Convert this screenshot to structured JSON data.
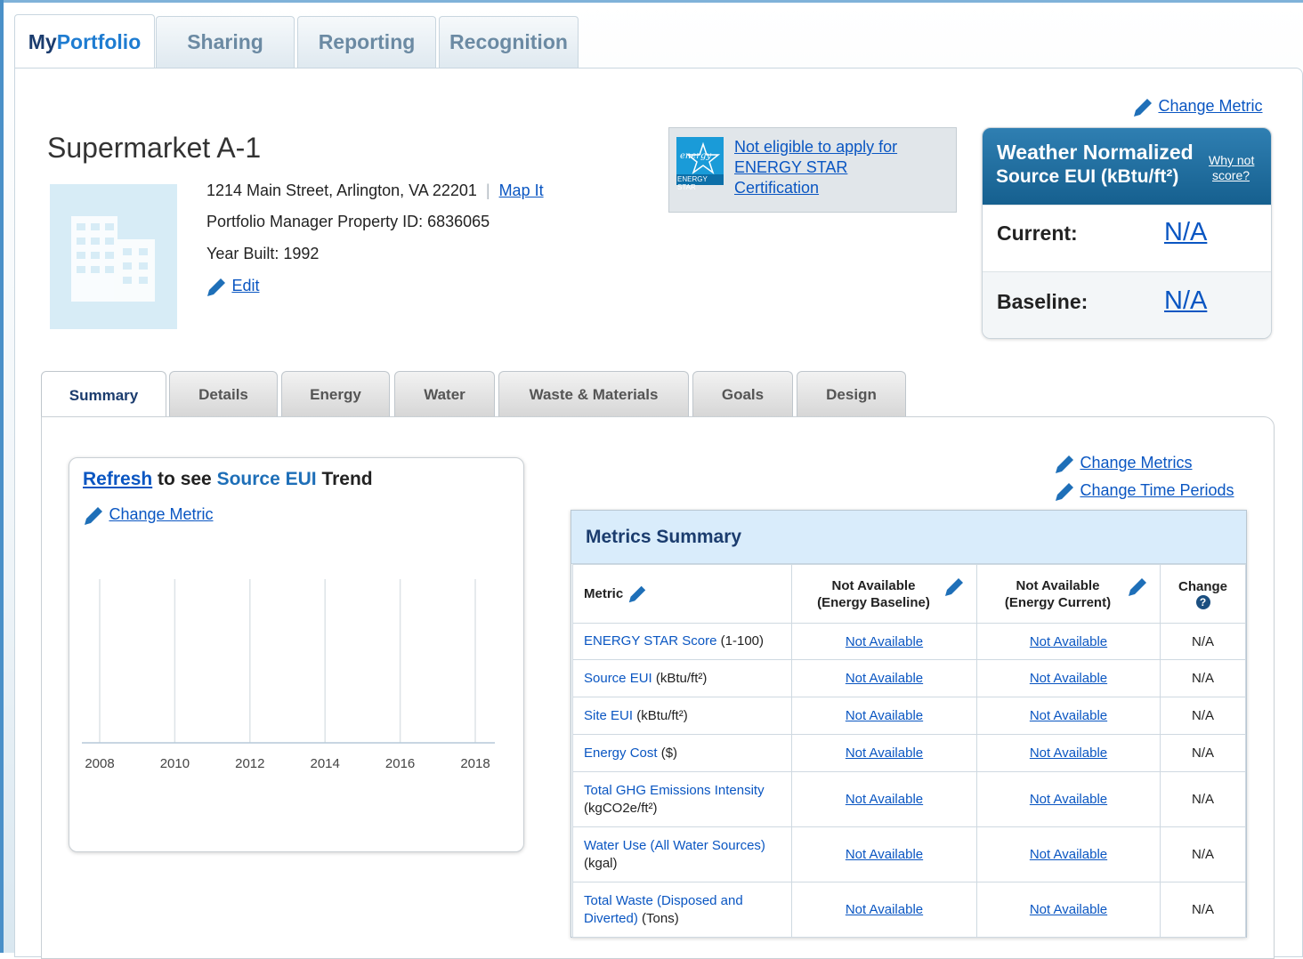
{
  "top_tabs": [
    {
      "label_a": "My",
      "label_b": "Portfolio"
    },
    {
      "label": "Sharing"
    },
    {
      "label": "Reporting"
    },
    {
      "label": "Recognition"
    }
  ],
  "header": {
    "change_metric": "Change Metric"
  },
  "property": {
    "name": "Supermarket A-1",
    "address": "1214 Main Street, Arlington, VA 22201",
    "separator": "|",
    "map_it": "Map It",
    "property_id": "Portfolio Manager Property ID: 6836065",
    "year_built": "Year Built: 1992",
    "edit": "Edit"
  },
  "energy_star_notice": {
    "logo_script": "energy",
    "logo_caption": "ENERGY STAR",
    "line1": "Not eligible to apply for",
    "line2": "ENERGY STAR",
    "line3": "Certification"
  },
  "weather_card": {
    "title_line1": "Weather Normalized",
    "title_line2": "Source EUI (kBtu/ft²)",
    "why_not_1": "Why not",
    "why_not_2": "score?",
    "current_label": "Current:",
    "current_value": "N/A",
    "baseline_label": "Baseline:",
    "baseline_value": "N/A"
  },
  "sub_tabs": [
    "Summary",
    "Details",
    "Energy",
    "Water",
    "Waste & Materials",
    "Goals",
    "Design"
  ],
  "trend": {
    "refresh": "Refresh",
    "to_see": " to see ",
    "metric": "Source EUI",
    "trend_word": " Trend",
    "change_metric": "Change Metric",
    "chart_data": {
      "type": "bar",
      "categories": [
        "2008",
        "2010",
        "2012",
        "2014",
        "2016",
        "2018"
      ],
      "values": [],
      "title": "",
      "grid": true
    }
  },
  "metrics_links": {
    "change_metrics": "Change Metrics",
    "change_time_periods": "Change Time Periods"
  },
  "metrics_summary": {
    "title": "Metrics Summary",
    "col_metric": "Metric",
    "col_baseline_1": "Not Available",
    "col_baseline_2": "(Energy Baseline)",
    "col_current_1": "Not Available",
    "col_current_2": "(Energy Current)",
    "col_change": "Change",
    "help_icon": "?",
    "rows": [
      {
        "name": "ENERGY STAR Score",
        "unit": " (1-100)",
        "baseline": "Not Available",
        "current": "Not Available",
        "change": "N/A"
      },
      {
        "name": "Source EUI",
        "unit": " (kBtu/ft²)",
        "baseline": "Not Available",
        "current": "Not Available",
        "change": "N/A"
      },
      {
        "name": "Site EUI",
        "unit": " (kBtu/ft²)",
        "baseline": "Not Available",
        "current": "Not Available",
        "change": "N/A"
      },
      {
        "name": "Energy Cost",
        "unit": " ($)",
        "baseline": "Not Available",
        "current": "Not Available",
        "change": "N/A"
      },
      {
        "name": "Total GHG Emissions Intensity",
        "unit": "(kgCO2e/ft²)",
        "baseline": "Not Available",
        "current": "Not Available",
        "change": "N/A"
      },
      {
        "name": "Water Use (All Water Sources)",
        "unit": "(kgal)",
        "baseline": "Not Available",
        "current": "Not Available",
        "change": "N/A"
      },
      {
        "name": "Total Waste (Disposed and Diverted)",
        "unit": " (Tons)",
        "baseline": "Not Available",
        "current": "Not Available",
        "change": "N/A"
      }
    ]
  }
}
